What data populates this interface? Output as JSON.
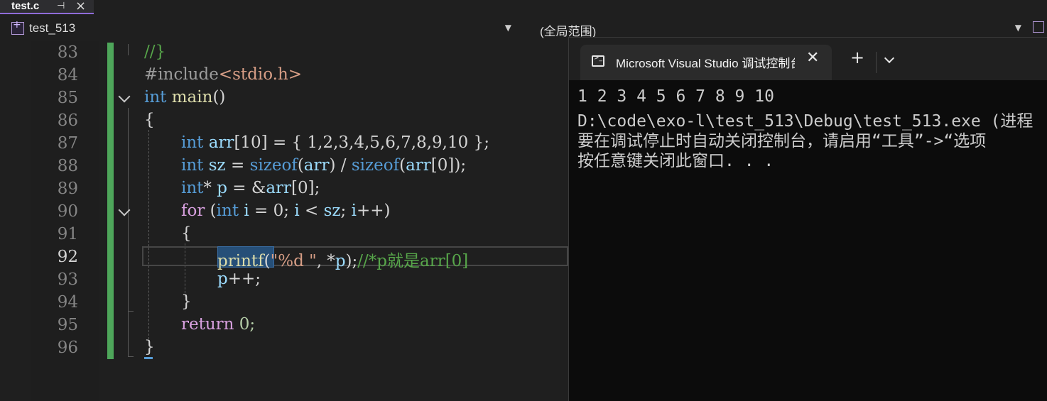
{
  "tab": {
    "title": "test.c"
  },
  "navbar": {
    "project_scope": "test_513",
    "global_scope": "(全局范围)"
  },
  "editor": {
    "line_numbers": [
      "83",
      "84",
      "85",
      "86",
      "87",
      "88",
      "89",
      "90",
      "91",
      "92",
      "93",
      "94",
      "95",
      "96"
    ],
    "active_line": "92",
    "code": {
      "l83": "//}",
      "l84_a": "#include",
      "l84_b": "<stdio.h>",
      "l85_kw": "int",
      "l85_fn": " main",
      "l85_p": "()",
      "l86": "{",
      "l87_kw": "int",
      "l87_var": " arr",
      "l87_rest": "[10] = { 1,2,3,4,5,6,7,8,9,10 };",
      "l88_kw": "int",
      "l88_var": " sz",
      "l88_op": " = ",
      "l88_fn1": "sizeof",
      "l88_p1": "(",
      "l88_v1": "arr",
      "l88_p2": ") / ",
      "l88_fn2": "sizeof",
      "l88_p3": "(",
      "l88_v2": "arr",
      "l88_p4": "[0]);",
      "l89_kw": "int",
      "l89_rest1": "* ",
      "l89_var": "p",
      "l89_rest2": " = &",
      "l89_v2": "arr",
      "l89_rest3": "[0];",
      "l90_kw": "for",
      "l90_p1": " (",
      "l90_kw2": "int",
      "l90_v1": " i",
      "l90_r1": " = 0; ",
      "l90_v2": "i",
      "l90_r2": " < ",
      "l90_v3": "sz",
      "l90_r3": "; ",
      "l90_v4": "i",
      "l90_r4": "++)",
      "l91": "{",
      "l92_fn": "printf",
      "l92_p1": "(",
      "l92_str": "\"%d \"",
      "l92_r1": ", *",
      "l92_var": "p",
      "l92_r2": ");",
      "l92_com": "//*p就是arr[0]",
      "l93_var": "p",
      "l93_rest": "++;",
      "l94": "}",
      "l95_kw": "return",
      "l95_rest": " 0;",
      "l96": "}"
    }
  },
  "console": {
    "tab_title": "Microsoft Visual Studio 调试控制台",
    "lines": [
      "1 2 3 4 5 6 7 8 9 10",
      "D:\\code\\exo-l\\test_513\\Debug\\test_513.exe (进程",
      "要在调试停止时自动关闭控制台，请启用“工具”->“选项",
      "按任意键关闭此窗口. . ."
    ]
  },
  "colors": {
    "editor_bg": "#1f1f1f",
    "keyword": "#569cd6",
    "function": "#dcdcaa",
    "variable": "#9cdcfe",
    "string": "#d69d85",
    "comment": "#57a64a",
    "change_bar": "#4ea65a",
    "console_bg": "#0c0c0c"
  }
}
